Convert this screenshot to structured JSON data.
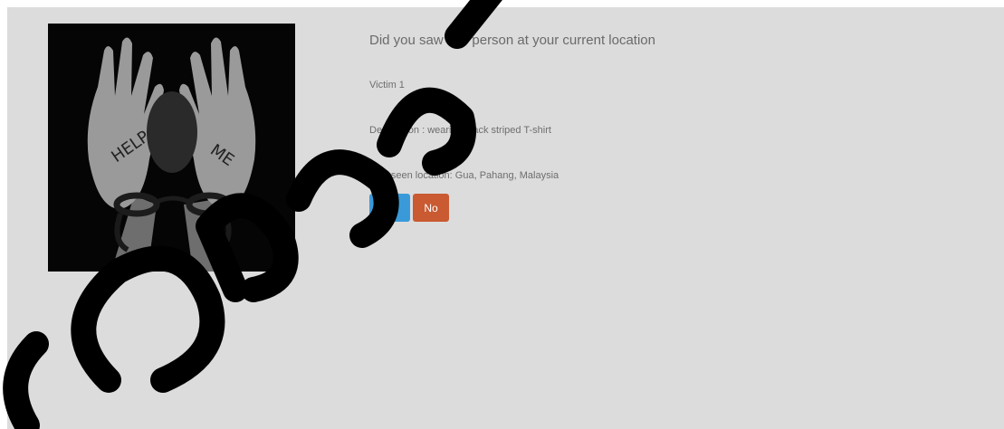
{
  "alert": {
    "question": "Did you saw this person at your current location",
    "name": "Victim 1",
    "description": "Description : wearing black striped T-shirt",
    "location": "Last seen location: Gua, Pahang, Malaysia",
    "photo_text_left": "HELP",
    "photo_text_right": "ME"
  },
  "actions": {
    "yes_label": "Yes",
    "no_label": "No"
  },
  "colors": {
    "panel_bg": "#dcdcdc",
    "yes_button": "#3a9ad9",
    "no_button": "#c95a32"
  }
}
